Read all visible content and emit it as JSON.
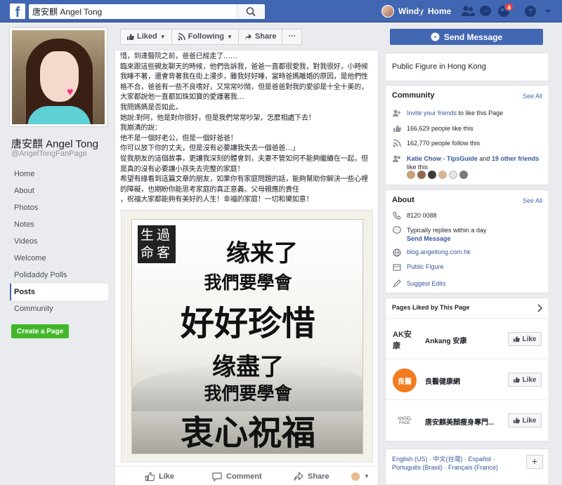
{
  "topbar": {
    "logo": "f",
    "search_value": "唐安麒 Angel Tong",
    "user_name": "Windy",
    "home_label": "Home",
    "notification_count": "4"
  },
  "left": {
    "page_name": "唐安麒 Angel Tong",
    "handle": "@AngelTongFanPage",
    "nav": [
      {
        "label": "Home"
      },
      {
        "label": "About"
      },
      {
        "label": "Photos"
      },
      {
        "label": "Notes"
      },
      {
        "label": "Videos"
      },
      {
        "label": "Welcome"
      },
      {
        "label": "Polidaddy Polls"
      },
      {
        "label": "Posts"
      },
      {
        "label": "Community"
      }
    ],
    "create_page": "Create a Page"
  },
  "actionbar": {
    "liked": "Liked",
    "following": "Following",
    "share": "Share",
    "more": "···",
    "send_message": "Send Message"
  },
  "post": {
    "text": "惜，到達醫院之前，爸爸已經走了……\n臨來跟這些親友聊天的時候，他們告訴我，爸爸一直都很愛我，對我很好，小時候我睡不著，還會背著我在街上漫步，雖我好好睡，當時爸媽離婚的原因，是他們性格不合，爸爸有一些不良嗜好，又常常吵鬧，但是爸爸對我的愛卻是十全十美的，大家都說他一直都如珠如寶的愛護著我…\n我問媽媽是否如此，\n她說:對阿，他是對你很好，但是我們常常吵架，怎麼相處下去！\n我崩潰的說：\n他不是一個好老公，但是一個好爸爸！\n你可以放下你的丈夫，但是沒有必要讓我失去一個爸爸…」\n從我朋友的這個故事，更讓我深刻的體會到，夫妻不管如何不能夠繼續在一起，但是真的沒有必要讓小孩失去完整的家庭！\n希望有緣看到這篇文章的朋友，如果你有家庭問題的話，能夠幫助你解決一些心裡的障礙，也期盼你能思考家庭的真正意義、父母親應的責任\n，祝福大家都能夠有美好的人生！幸福的家庭！一切和樂如意！",
    "image": {
      "seal": "生過命客",
      "line1": "缘来了",
      "line2": "我們要學會",
      "line3": "好好珍惜",
      "line4": "缘盡了",
      "line5": "我們要學會",
      "line6": "衷心祝福"
    },
    "footer": {
      "like": "Like",
      "comment": "Comment",
      "share": "Share"
    }
  },
  "right": {
    "category": "Public Figure in Hong Kong",
    "community": {
      "title": "Community",
      "see_all": "See All",
      "invite_link": "Invite your friends",
      "invite_rest": " to like this Page",
      "likes": "166,629 people like this",
      "follows": "162,770 people follow this",
      "friends_name": "Katie Chow - TipsGuide",
      "friends_and": " and ",
      "friends_others": "19 other friends",
      "friends_like": "like this"
    },
    "about": {
      "title": "About",
      "see_all": "See All",
      "phone": "8120 0088",
      "reply_text": "Typically replies within a day",
      "send_message": "Send Message",
      "website": "blog.angeltong.com.hk",
      "category_link": "Public Figure",
      "suggest": "Suggest Edits"
    },
    "pages_liked": {
      "title": "Pages Liked by This Page",
      "items": [
        {
          "name": "Ankang 安康",
          "logo": "AK安康",
          "like": "Like"
        },
        {
          "name": "良醫健康網",
          "logo": "良醫",
          "like": "Like"
        },
        {
          "name": "唐安麒美顏瘦身專門...",
          "logo": "ANGEL FACE",
          "like": "Like"
        }
      ]
    },
    "languages": "English (US) · 中文(台灣) · Español · Português (Brasil) · Français (France)"
  },
  "colors": {
    "brand": "#4267b2",
    "green": "#42b72a",
    "link": "#365899"
  }
}
